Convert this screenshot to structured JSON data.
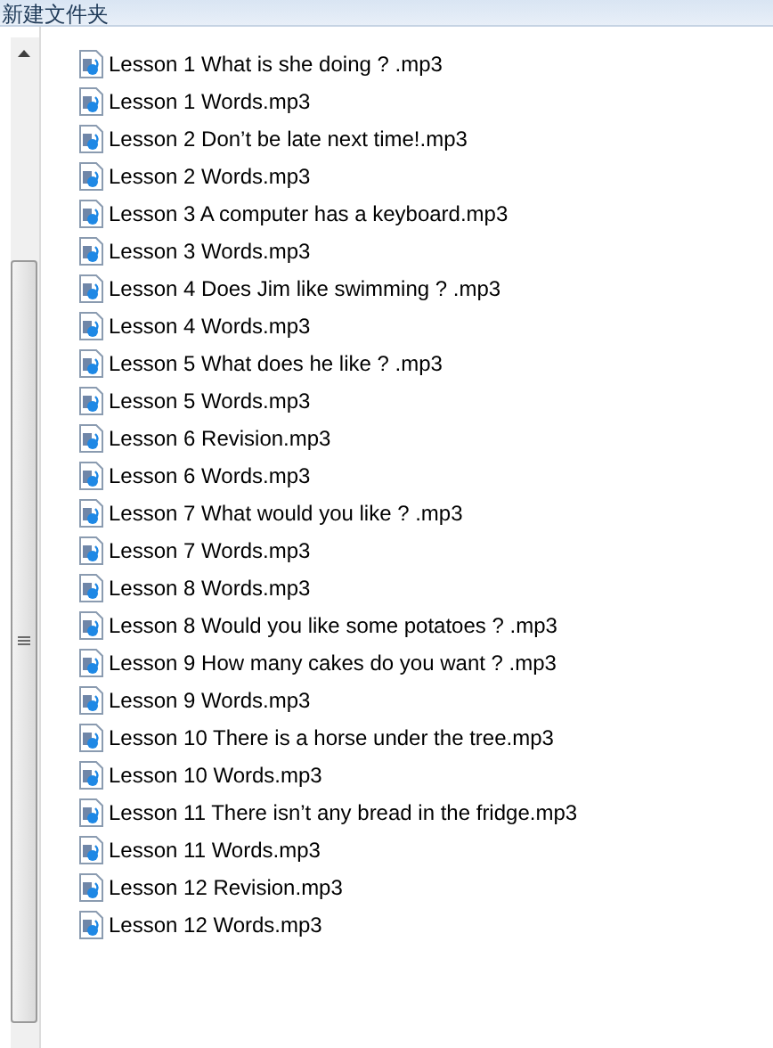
{
  "window": {
    "title": "新建文件夹"
  },
  "files": [
    {
      "name": "Lesson 1 What is she doing ? .mp3"
    },
    {
      "name": "Lesson 1 Words.mp3"
    },
    {
      "name": "Lesson 2 Don’t be late next time!.mp3"
    },
    {
      "name": "Lesson 2 Words.mp3"
    },
    {
      "name": "Lesson 3 A computer has a keyboard.mp3"
    },
    {
      "name": "Lesson 3 Words.mp3"
    },
    {
      "name": "Lesson 4 Does Jim like swimming ? .mp3"
    },
    {
      "name": "Lesson 4 Words.mp3"
    },
    {
      "name": "Lesson 5 What does he like ? .mp3"
    },
    {
      "name": "Lesson 5 Words.mp3"
    },
    {
      "name": "Lesson 6 Revision.mp3"
    },
    {
      "name": "Lesson 6 Words.mp3"
    },
    {
      "name": "Lesson 7 What would you like ? .mp3"
    },
    {
      "name": "Lesson 7 Words.mp3"
    },
    {
      "name": "Lesson 8 Words.mp3"
    },
    {
      "name": "Lesson 8 Would you like some potatoes ? .mp3"
    },
    {
      "name": "Lesson 9 How many cakes do you want ? .mp3"
    },
    {
      "name": "Lesson 9 Words.mp3"
    },
    {
      "name": "Lesson 10 There is a horse under the tree.mp3"
    },
    {
      "name": "Lesson 10 Words.mp3"
    },
    {
      "name": "Lesson 11 There isn’t any bread in the fridge.mp3"
    },
    {
      "name": "Lesson 11 Words.mp3"
    },
    {
      "name": "Lesson 12 Revision.mp3"
    },
    {
      "name": "Lesson 12 Words.mp3"
    }
  ]
}
